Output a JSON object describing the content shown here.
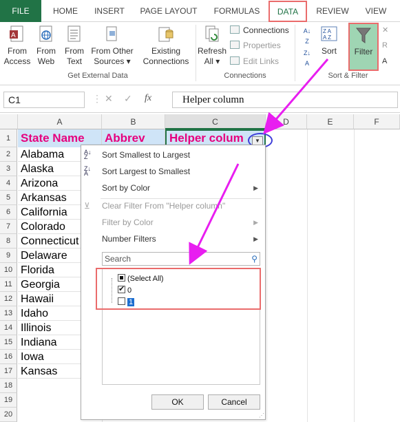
{
  "tabs": [
    "FILE",
    "HOME",
    "INSERT",
    "PAGE LAYOUT",
    "FORMULAS",
    "DATA",
    "REVIEW",
    "VIEW"
  ],
  "ribbon": {
    "from_access": "From\nAccess",
    "from_web": "From\nWeb",
    "from_text": "From\nText",
    "from_other": "From Other\nSources ▾",
    "existing": "Existing\nConnections",
    "get_external": "Get External Data",
    "refresh": "Refresh\nAll ▾",
    "connections": "Connections",
    "properties": "Properties",
    "edit_links": "Edit Links",
    "connections_group": "Connections",
    "sort": "Sort",
    "filter": "Filter",
    "sort_filter_group": "Sort & Filter"
  },
  "formula_bar": {
    "name_box": "C1",
    "fx": "fx",
    "formula": "Helper column"
  },
  "columns": [
    "A",
    "B",
    "C",
    "D",
    "E",
    "F"
  ],
  "rows": [
    "1",
    "2",
    "3",
    "4",
    "5",
    "6",
    "7",
    "8",
    "9",
    "10",
    "11",
    "12",
    "13",
    "14",
    "15",
    "16",
    "17",
    "18",
    "19",
    "20"
  ],
  "headers": {
    "a": "State Name",
    "b": "Abbrev",
    "c": "Helper colum"
  },
  "states": [
    "Alabama",
    "Alaska",
    "Arizona",
    "Arkansas",
    "California",
    "Colorado",
    "Connecticut",
    "Delaware",
    "Florida",
    "Georgia",
    "Hawaii",
    "Idaho",
    "Illinois",
    "Indiana",
    "Iowa",
    "Kansas"
  ],
  "menu": {
    "sort_asc": "Sort Smallest to Largest",
    "sort_desc": "Sort Largest to Smallest",
    "sort_color": "Sort by Color",
    "clear_filter": "Clear Filter From \"Helper column\"",
    "filter_color": "Filter by Color",
    "number_filters": "Number Filters",
    "search_placeholder": "Search",
    "select_all": "(Select All)",
    "opt0": "0",
    "opt1": "1",
    "ok": "OK",
    "cancel": "Cancel"
  },
  "colors": {
    "excel_green": "#217346",
    "highlight": "#ea6b6b",
    "header_text": "#e6007e",
    "arrow": "#e81ef0"
  }
}
